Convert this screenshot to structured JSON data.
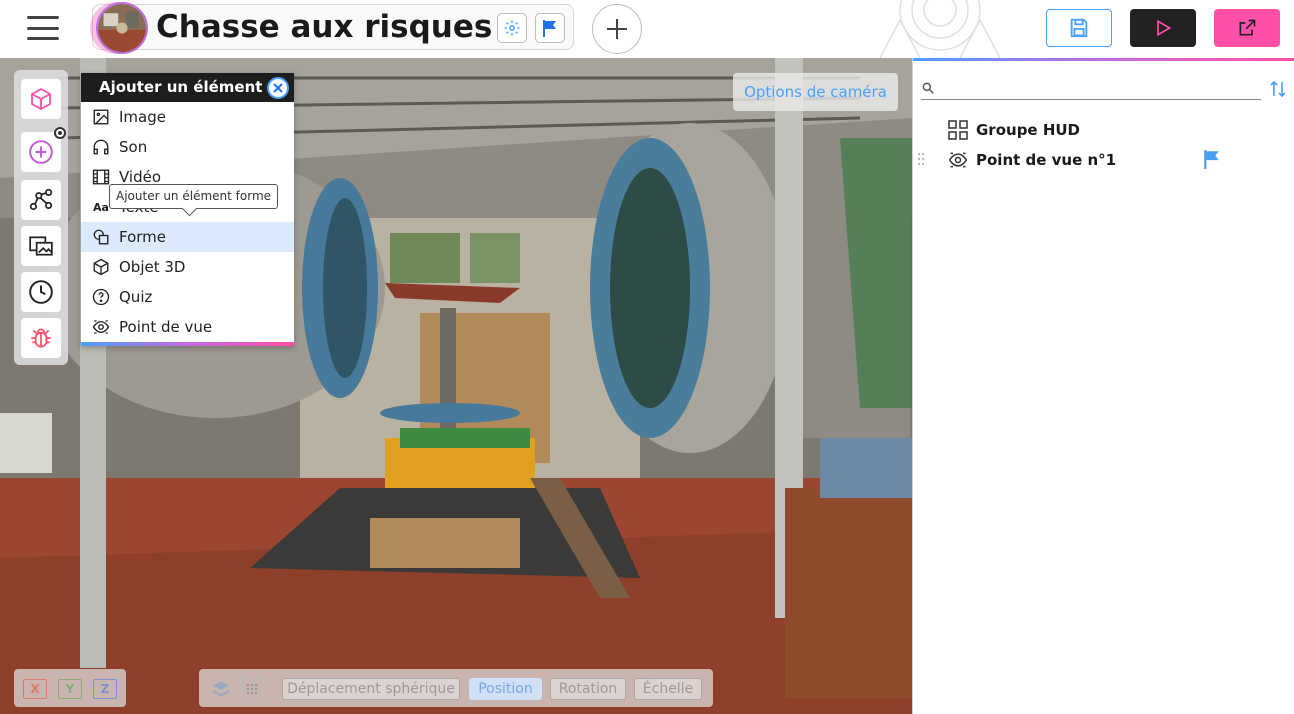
{
  "header": {
    "project_title": "Chasse aux risques",
    "colors": {
      "accent_blue": "#4aa0ff",
      "accent_pink": "#ff4fa8",
      "dark": "#222222"
    }
  },
  "add_panel": {
    "title": "Ajouter un élément",
    "items": [
      {
        "label": "Image",
        "icon": "image-icon"
      },
      {
        "label": "Son",
        "icon": "headphones-icon"
      },
      {
        "label": "Vidéo",
        "icon": "film-icon"
      },
      {
        "label": "Texte",
        "icon": "text-icon"
      },
      {
        "label": "Forme",
        "icon": "shapes-icon"
      },
      {
        "label": "Objet 3D",
        "icon": "cube-icon"
      },
      {
        "label": "Quiz",
        "icon": "question-icon"
      },
      {
        "label": "Point de vue",
        "icon": "eye-icon"
      }
    ],
    "tooltip": "Ajouter un élément forme"
  },
  "viewport": {
    "camera_options": "Options de caméra",
    "axes": {
      "x": "X",
      "y": "Y",
      "z": "Z"
    },
    "transform_modes": {
      "spherical": "Déplacement sphérique",
      "position": "Position",
      "rotation": "Rotation",
      "scale": "Échelle"
    }
  },
  "scene_tree": {
    "search_placeholder": "",
    "items": [
      {
        "label": "Groupe HUD",
        "icon": "grid-icon"
      },
      {
        "label": "Point de vue n°1",
        "icon": "eye-icon"
      }
    ]
  }
}
